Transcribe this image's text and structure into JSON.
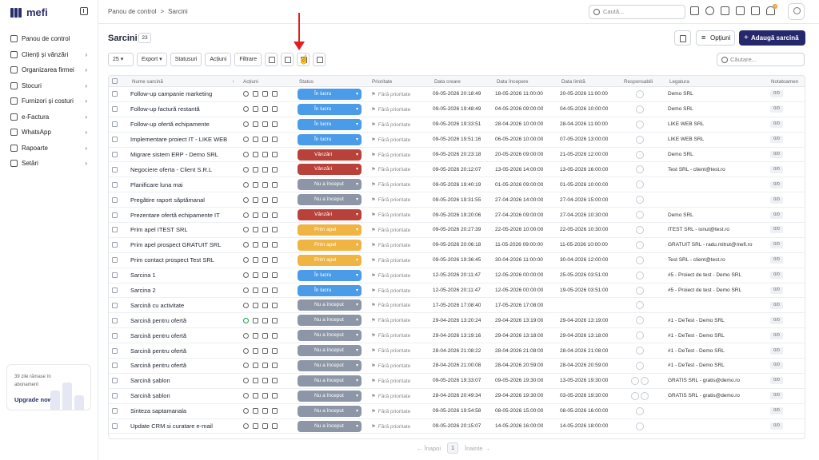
{
  "app": {
    "brand": "mefi"
  },
  "sidebar": {
    "items": [
      {
        "label": "Panou de control",
        "icon": "home-icon",
        "chev": false
      },
      {
        "label": "Clienți și vânzări",
        "icon": "users-icon",
        "chev": true
      },
      {
        "label": "Organizarea firmei",
        "icon": "org-icon",
        "chev": true
      },
      {
        "label": "Stocuri",
        "icon": "box-icon",
        "chev": true
      },
      {
        "label": "Furnizori și costuri",
        "icon": "truck-icon",
        "chev": true
      },
      {
        "label": "e-Factura",
        "icon": "invoice-icon",
        "chev": true
      },
      {
        "label": "WhatsApp",
        "icon": "whatsapp-icon",
        "chev": true
      },
      {
        "label": "Rapoarte",
        "icon": "report-icon",
        "chev": true
      },
      {
        "label": "Setări",
        "icon": "gear-icon",
        "chev": true
      }
    ],
    "trial": {
      "text": "39 zile rămase în abonament",
      "cta": "Upgrade now →"
    }
  },
  "topbar": {
    "breadcrumb_root": "Panou de control",
    "breadcrumb_sep": ">",
    "breadcrumb_current": "Sarcini",
    "search_placeholder": "Caută...",
    "notif_count": "1"
  },
  "page": {
    "title": "Sarcini",
    "count": "23",
    "options_label": "Opțiuni",
    "add_label": "Adaugă sarcină"
  },
  "toolbar": {
    "page_size": "25 ▾",
    "export": "Export ▾",
    "statuses": "Statusuri",
    "actions": "Acțiuni",
    "filters": "Filtrare",
    "search_placeholder": "Căutare..."
  },
  "table": {
    "headers": {
      "name": "Nume sarcină",
      "actions": "Acțiuni",
      "status": "Status",
      "priority": "Prioritate",
      "created": "Data creare",
      "start": "Data începere",
      "due": "Data limită",
      "resp": "Responsabili",
      "link": "Legatura",
      "notes": "Notatoamen"
    }
  },
  "status_colors": {
    "În lucru": "#4a9be8",
    "Vânzări": "#b8413a",
    "Nu a început": "#8d96a6",
    "Prim apel": "#f0b442"
  },
  "rows": [
    {
      "name": "Follow-up campanie marketing",
      "status": "În lucru",
      "priority": "Fără prioritate",
      "created": "09-05-2026 20:18:49",
      "start": "18-05-2026 11:00:00",
      "due": "20-05-2026 11:00:00",
      "resp": 1,
      "link": "Demo SRL",
      "notes": "0/0"
    },
    {
      "name": "Follow-up factură restantă",
      "status": "În lucru",
      "priority": "Fără prioritate",
      "created": "09-05-2026 19:48:49",
      "start": "04-05-2026 09:00:00",
      "due": "04-05-2026 10:00:00",
      "resp": 1,
      "link": "Demo SRL",
      "notes": "0/0"
    },
    {
      "name": "Follow-up ofertă echipamente",
      "status": "În lucru",
      "priority": "Fără prioritate",
      "created": "09-05-2026 19:33:51",
      "start": "28-04-2026 10:00:00",
      "due": "28-04-2026 11:00:00",
      "resp": 1,
      "link": "LIKE WEB SRL",
      "notes": "0/0"
    },
    {
      "name": "Implementare proiect IT - LIKE WEB",
      "status": "În lucru",
      "priority": "Fără prioritate",
      "created": "09-05-2026 19:51:16",
      "start": "06-05-2026 10:00:00",
      "due": "07-05-2026 13:00:00",
      "resp": 1,
      "link": "LIKE WEB SRL",
      "notes": "0/0"
    },
    {
      "name": "Migrare sistem ERP - Demo SRL",
      "status": "Vânzări",
      "priority": "Fără prioritate",
      "created": "09-05-2026 20:23:18",
      "start": "20-05-2026 09:00:00",
      "due": "21-05-2026 12:00:00",
      "resp": 1,
      "link": "Demo SRL",
      "notes": "0/0"
    },
    {
      "name": "Negociere oferta - Client S.R.L",
      "status": "Vânzări",
      "priority": "Fără prioritate",
      "created": "09-05-2026 20:12:07",
      "start": "13-05-2026 14:00:00",
      "due": "13-05-2026 16:00:00",
      "resp": 1,
      "link": "Test SRL - client@test.ro",
      "notes": "0/0"
    },
    {
      "name": "Planificare luna mai",
      "status": "Nu a început",
      "priority": "Fără prioritate",
      "created": "09-05-2026 19:40:19",
      "start": "01-05-2026 09:00:00",
      "due": "01-05-2026 10:00:00",
      "resp": 1,
      "link": "",
      "notes": "0/0"
    },
    {
      "name": "Pregătire raport săptămanal",
      "status": "Nu a început",
      "priority": "Fără prioritate",
      "created": "09-05-2026 19:31:55",
      "start": "27-04-2026 14:00:00",
      "due": "27-04-2026 15:00:00",
      "resp": 1,
      "link": "",
      "notes": "0/0"
    },
    {
      "name": "Prezentare ofertă echipamente IT",
      "status": "Vânzări",
      "priority": "Fără prioritate",
      "created": "09-05-2026 19:20:06",
      "start": "27-04-2026 09:00:00",
      "due": "27-04-2026 10:30:00",
      "resp": 1,
      "link": "Demo SRL",
      "notes": "0/0"
    },
    {
      "name": "Prim apel ITEST SRL",
      "status": "Prim apel",
      "priority": "Fără prioritate",
      "created": "09-05-2026 20:27:39",
      "start": "22-05-2026 10:00:00",
      "due": "22-05-2026 10:30:00",
      "resp": 1,
      "link": "ITEST SRL - ionut@test.ro",
      "notes": "0/0"
    },
    {
      "name": "Prim apel prospect GRATUIT SRL",
      "status": "Prim apel",
      "priority": "Fără prioritate",
      "created": "09-05-2026 20:06:18",
      "start": "11-05-2026 09:00:00",
      "due": "11-05-2026 10:00:00",
      "resp": 1,
      "link": "GRATUIT SRL - radu.mitrut@mefi.ro",
      "notes": "0/0"
    },
    {
      "name": "Prim contact prospect Test SRL",
      "status": "Prim apel",
      "priority": "Fără prioritate",
      "created": "09-05-2026 19:36:45",
      "start": "30-04-2026 11:00:00",
      "due": "30-04-2026 12:00:00",
      "resp": 1,
      "link": "Test SRL - client@test.ro",
      "notes": "0/0"
    },
    {
      "name": "Sarcina 1",
      "status": "În lucru",
      "priority": "Fără prioritate",
      "created": "12-05-2026 20:11:47",
      "start": "12-05-2026 00:00:00",
      "due": "25-05-2026 03:51:00",
      "resp": 1,
      "link": "#5 - Proiect de test - Demo SRL",
      "notes": "0/0"
    },
    {
      "name": "Sarcina 2",
      "status": "În lucru",
      "priority": "Fără prioritate",
      "created": "12-05-2026 20:11:47",
      "start": "12-05-2026 00:00:00",
      "due": "19-05-2026 03:51:00",
      "resp": 1,
      "link": "#5 - Proiect de test - Demo SRL",
      "notes": "0/0"
    },
    {
      "name": "Sarcină cu activitate",
      "status": "Nu a început",
      "priority": "Fără prioritate",
      "created": "17-05-2026 17:08:40",
      "start": "17-05-2026 17:08:00",
      "due": "",
      "resp": 1,
      "link": "",
      "notes": "0/0"
    },
    {
      "name": "Sarcină pentru ofertă",
      "status": "Nu a început",
      "priority": "Fără prioritate",
      "created": "29-04-2026 13:20:24",
      "start": "29-04-2026 13:19:00",
      "due": "29-04-2026 13:19:00",
      "resp": 1,
      "link": "#1 - DeTest - Demo SRL",
      "notes": "0/0",
      "play": true
    },
    {
      "name": "Sarcină pentru ofertă",
      "status": "Nu a început",
      "priority": "Fără prioritate",
      "created": "29-04-2026 13:19:16",
      "start": "29-04-2026 13:18:00",
      "due": "29-04-2026 13:18:00",
      "resp": 1,
      "link": "#1 - DeTest - Demo SRL",
      "notes": "0/0"
    },
    {
      "name": "Sarcină pentru ofertă",
      "status": "Nu a început",
      "priority": "Fără prioritate",
      "created": "28-04-2026 21:08:22",
      "start": "28-04-2026 21:08:00",
      "due": "28-04-2026 21:08:00",
      "resp": 1,
      "link": "#1 - DeTest - Demo SRL",
      "notes": "0/0"
    },
    {
      "name": "Sarcină pentru ofertă",
      "status": "Nu a început",
      "priority": "Fără prioritate",
      "created": "28-04-2026 21:00:08",
      "start": "28-04-2026 20:59:00",
      "due": "28-04-2026 20:59:00",
      "resp": 1,
      "link": "#1 - DeTest - Demo SRL",
      "notes": "0/0"
    },
    {
      "name": "Sarcină șablon",
      "status": "Nu a început",
      "priority": "Fără prioritate",
      "created": "09-05-2026 19:33:07",
      "start": "09-05-2026 19:30:00",
      "due": "13-05-2026 19:30:00",
      "resp": 2,
      "link": "GRATIS SRL - gratis@demo.ro",
      "notes": "0/0"
    },
    {
      "name": "Sarcină șablon",
      "status": "Nu a început",
      "priority": "Fără prioritate",
      "created": "28-04-2026 20:49:34",
      "start": "29-04-2026 19:30:00",
      "due": "03-05-2026 19:30:00",
      "resp": 2,
      "link": "GRATIS SRL - gratis@demo.ro",
      "notes": "0/0"
    },
    {
      "name": "Sinteza saptamanala",
      "status": "Nu a început",
      "priority": "Fără prioritate",
      "created": "09-05-2026 19:54:58",
      "start": "08-05-2026 15:00:00",
      "due": "08-05-2026 16:00:00",
      "resp": 1,
      "link": "",
      "notes": "0/0"
    },
    {
      "name": "Update CRM si curatare e-mail",
      "status": "Nu a început",
      "priority": "Fără prioritate",
      "created": "09-05-2026 20:15:07",
      "start": "14-05-2026 16:00:00",
      "due": "14-05-2026 18:00:00",
      "resp": 1,
      "link": "",
      "notes": "0/0"
    }
  ],
  "pager": {
    "prev": "← Înapoi",
    "page": "1",
    "next": "Înainte →"
  }
}
